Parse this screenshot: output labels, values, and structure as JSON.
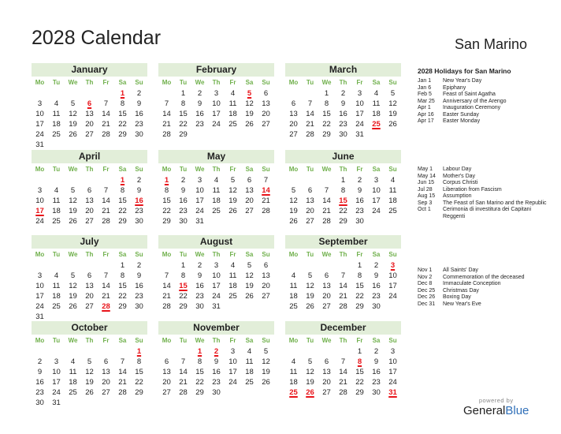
{
  "title": "2028 Calendar",
  "country": "San Marino",
  "weekday_labels": [
    "Mo",
    "Tu",
    "We",
    "Th",
    "Fr",
    "Sa",
    "Su"
  ],
  "months": [
    {
      "name": "January",
      "offset": 5,
      "days": 31,
      "holidays": [
        1,
        6
      ]
    },
    {
      "name": "February",
      "offset": 1,
      "days": 29,
      "holidays": [
        5
      ]
    },
    {
      "name": "March",
      "offset": 2,
      "days": 31,
      "holidays": [
        25
      ]
    },
    {
      "name": "April",
      "offset": 5,
      "days": 30,
      "holidays": [
        1,
        16,
        17
      ]
    },
    {
      "name": "May",
      "offset": 0,
      "days": 31,
      "holidays": [
        1,
        14
      ]
    },
    {
      "name": "June",
      "offset": 3,
      "days": 30,
      "holidays": [
        15
      ]
    },
    {
      "name": "July",
      "offset": 5,
      "days": 31,
      "holidays": [
        28
      ]
    },
    {
      "name": "August",
      "offset": 1,
      "days": 31,
      "holidays": [
        15
      ]
    },
    {
      "name": "September",
      "offset": 4,
      "days": 30,
      "holidays": [
        3
      ]
    },
    {
      "name": "October",
      "offset": 6,
      "days": 31,
      "holidays": [
        1
      ]
    },
    {
      "name": "November",
      "offset": 2,
      "days": 30,
      "holidays": [
        1,
        2
      ]
    },
    {
      "name": "December",
      "offset": 4,
      "days": 31,
      "holidays": [
        8,
        25,
        26,
        31
      ]
    }
  ],
  "holidays_title": "2028 Holidays for San Marino",
  "holiday_groups": [
    [
      {
        "date": "Jan 1",
        "name": "New Year's Day"
      },
      {
        "date": "Jan 6",
        "name": "Epiphany"
      },
      {
        "date": "Feb 5",
        "name": "Feast of Saint Agatha"
      },
      {
        "date": "Mar 25",
        "name": "Anniversary of the Arengo"
      },
      {
        "date": "Apr 1",
        "name": "Inauguration Ceremony"
      },
      {
        "date": "Apr 16",
        "name": "Easter Sunday"
      },
      {
        "date": "Apr 17",
        "name": "Easter Monday"
      }
    ],
    [
      {
        "date": "May 1",
        "name": "Labour Day"
      },
      {
        "date": "May 14",
        "name": "Mother's Day"
      },
      {
        "date": "Jun 15",
        "name": "Corpus Christi"
      },
      {
        "date": "Jul 28",
        "name": "Liberation from Fascism"
      },
      {
        "date": "Aug 15",
        "name": "Assumption"
      },
      {
        "date": "Sep 3",
        "name": "The Feast of San Marino and the Republic"
      },
      {
        "date": "Oct 1",
        "name": "Cerimonia di investitura dei Capitani Reggenti"
      }
    ],
    [
      {
        "date": "Nov 1",
        "name": "All Saints' Day"
      },
      {
        "date": "Nov 2",
        "name": "Commemoration of the deceased"
      },
      {
        "date": "Dec 8",
        "name": "Immaculate Conception"
      },
      {
        "date": "Dec 25",
        "name": "Christmas Day"
      },
      {
        "date": "Dec 26",
        "name": "Boxing Day"
      },
      {
        "date": "Dec 31",
        "name": "New Year's Eve"
      }
    ]
  ],
  "logo": {
    "powered": "powered by",
    "brand_a": "General",
    "brand_b": "Blue"
  },
  "colors": {
    "header_bg": "#e2eed9",
    "weekday": "#70b04c",
    "holiday": "#e8141a",
    "brand_blue": "#2f6fb8"
  }
}
